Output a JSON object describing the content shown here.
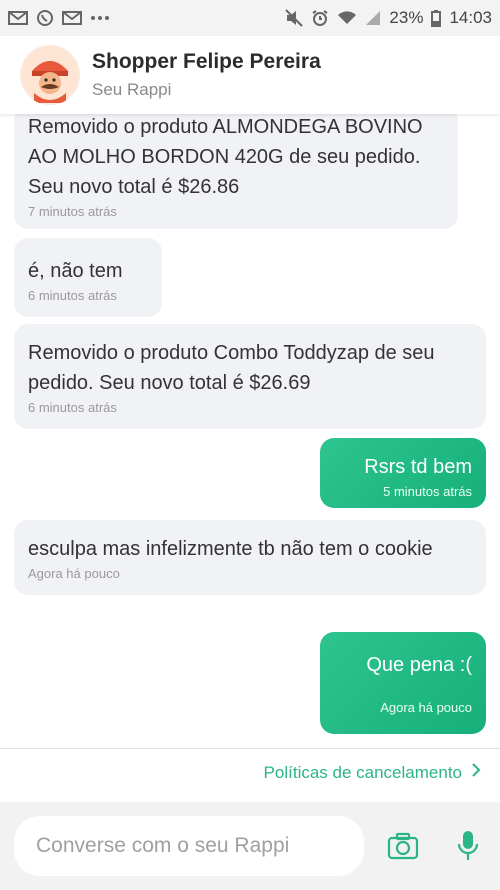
{
  "statusbar": {
    "battery_percent": "23%",
    "time": "14:03",
    "left_icons": [
      "gmail-icon",
      "whatsapp-icon",
      "gmail-icon",
      "more-dots-icon"
    ],
    "right_icons": [
      "mute-icon",
      "alarm-icon",
      "wifi-icon",
      "signal-icon",
      "battery-icon"
    ]
  },
  "header": {
    "name": "Shopper Felipe  Pereira",
    "subtitle": "Seu Rappi"
  },
  "messages": [
    {
      "dir": "in",
      "text": "Removido o produto ALMONDEGA BOVINO AO MOLHO BORDON 420G de seu pedido. Seu novo total é $26.86",
      "time": "7 minutos atrás"
    },
    {
      "dir": "in",
      "text": "é, não tem",
      "time": "6 minutos atrás"
    },
    {
      "dir": "in",
      "text": "Removido o produto Combo Toddyzap de seu pedido. Seu novo total é $26.69",
      "time": "6 minutos atrás"
    },
    {
      "dir": "out",
      "text": "Rsrs td bem",
      "time": "5 minutos atrás"
    },
    {
      "dir": "in",
      "text": "esculpa mas infelizmente tb não tem o cookie",
      "time": "Agora há pouco"
    },
    {
      "dir": "out",
      "text": "Que pena :(",
      "time": "Agora há pouco"
    }
  ],
  "policy_link": "Políticas de cancelamento",
  "input": {
    "placeholder": "Converse com o seu Rappi",
    "value": ""
  },
  "colors": {
    "accent": "#2bb585",
    "bubble_in": "#f1f2f5",
    "bubble_out": "#17b07a"
  }
}
